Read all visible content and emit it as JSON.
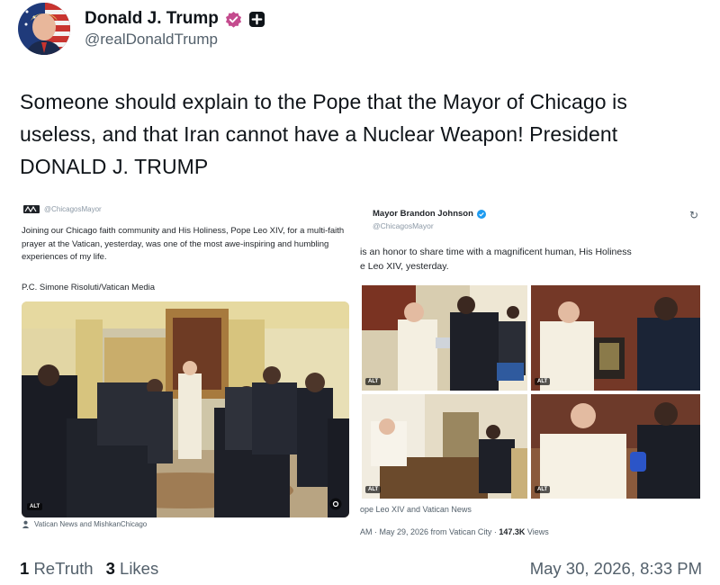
{
  "author": {
    "display_name": "Donald J. Trump",
    "handle": "@realDonaldTrump",
    "avatar_icon": "flag-portrait-avatar",
    "verified_icon": "verified-badge-icon",
    "follow_icon": "plus-icon"
  },
  "post": {
    "text_line1": "Someone should explain to the Pope that the Mayor of Chicago is",
    "text_line2": "useless, and that Iran cannot have a Nuclear Weapon! President",
    "text_line3": "DONALD J. TRUMP"
  },
  "embed_left": {
    "handle": "@ChicagosMayor",
    "text": "Joining our Chicago faith community and His Holiness, Pope Leo XIV, for a multi-faith prayer at the Vatican, yesterday, was one of the most awe-inspiring and humbling experiences of my life.",
    "credit": "P.C. Simone Risoluti/Vatican Media",
    "alt_label": "ALT",
    "photo_source": "Vatican News and MishkanChicago"
  },
  "embed_right": {
    "display_name": "Mayor Brandon Johnson",
    "handle": "@ChicagosMayor",
    "text_line1": "is an honor to share time with a magnificent human, His Holiness",
    "text_line2": "e Leo XIV, yesterday.",
    "alt_label": "ALT",
    "photo_source": "ope Leo XIV and Vatican News",
    "meta_prefix": "AM · May 29, 2026 from Vatican City · ",
    "views_count": "147.3K",
    "views_label": " Views"
  },
  "footer": {
    "retruths_count": "1",
    "retruths_label": "ReTruth",
    "likes_count": "3",
    "likes_label": "Likes",
    "timestamp": "May 30, 2026, 8:33 PM"
  },
  "colors": {
    "text": "#0f1419",
    "muted": "#53606b",
    "verified": "#c44b8e",
    "link_blue": "#1d9bf0"
  }
}
